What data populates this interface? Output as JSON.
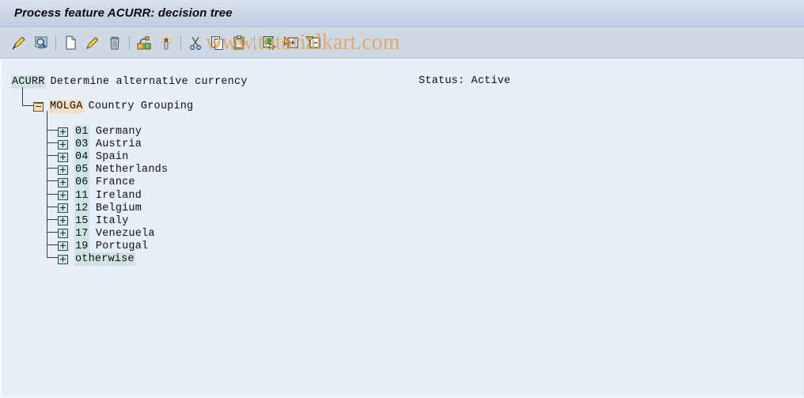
{
  "window": {
    "title": "Process feature ACURR: decision tree"
  },
  "toolbar": {
    "buttons": [
      {
        "name": "change-mode-icon",
        "title": "Change"
      },
      {
        "name": "display-mode-icon",
        "title": "Display"
      },
      {
        "name": "create-icon",
        "title": "Create"
      },
      {
        "name": "edit-icon",
        "title": "Change node"
      },
      {
        "name": "delete-icon",
        "title": "Delete"
      },
      {
        "name": "node-structure-icon",
        "title": "Structure"
      },
      {
        "name": "highlight-icon",
        "title": "Highlight"
      },
      {
        "name": "cut-icon",
        "title": "Cut"
      },
      {
        "name": "copy-icon",
        "title": "Copy"
      },
      {
        "name": "paste-icon",
        "title": "Paste"
      },
      {
        "name": "select-subtree-icon",
        "title": "Select subtree"
      },
      {
        "name": "expand-node-icon",
        "title": "Expand node"
      },
      {
        "name": "collapse-node-icon",
        "title": "Collapse node"
      }
    ]
  },
  "watermark": {
    "text": "www.tutorialkart.com",
    "color": "#e8a057"
  },
  "tree": {
    "root": {
      "code": "ACURR",
      "description": "Determine alternative currency"
    },
    "status": "Status: Active",
    "branch": {
      "code": "MOLGA",
      "description": "Country Grouping",
      "icon": "folder-collapse-icon"
    },
    "leaves": [
      {
        "code": "01",
        "label": "Germany"
      },
      {
        "code": "03",
        "label": "Austria"
      },
      {
        "code": "04",
        "label": "Spain"
      },
      {
        "code": "05",
        "label": "Netherlands"
      },
      {
        "code": "06",
        "label": "France"
      },
      {
        "code": "11",
        "label": "Ireland"
      },
      {
        "code": "12",
        "label": "Belgium"
      },
      {
        "code": "15",
        "label": "Italy"
      },
      {
        "code": "17",
        "label": "Venezuela"
      },
      {
        "code": "19",
        "label": "Portugal"
      },
      {
        "code": "",
        "label": "otherwise"
      }
    ]
  },
  "colors": {
    "titlebar": "#c9d6e5",
    "toolbar": "#ced8e3",
    "content_bg": "#e8eef7",
    "highlight_cyan": "#cfe4e2",
    "highlight_tan": "#f6dfc0"
  }
}
